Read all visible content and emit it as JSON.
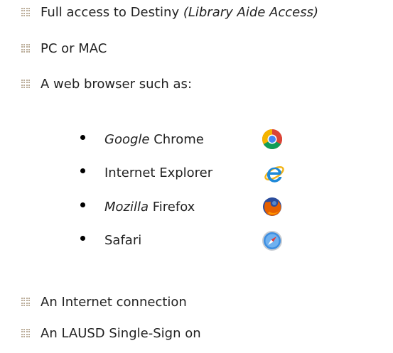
{
  "requirements": [
    {
      "text": "Full access to Destiny ",
      "italic": "(Library Aide Access)"
    },
    {
      "text": "PC or MAC"
    },
    {
      "text": "A web browser such as:"
    },
    {
      "text": "An Internet connection"
    },
    {
      "text": "An LAUSD Single-Sign on"
    }
  ],
  "browsers": [
    {
      "italic": "Google",
      "text": " Chrome",
      "icon": "chrome-icon"
    },
    {
      "italic": "",
      "text": "Internet Explorer",
      "icon": "internet-explorer-icon"
    },
    {
      "italic": "Mozilla",
      "text": " Firefox",
      "icon": "firefox-icon"
    },
    {
      "italic": "",
      "text": "Safari",
      "icon": "safari-icon"
    }
  ],
  "colors": {
    "bullet": "#b4a58f",
    "text": "#222222"
  }
}
